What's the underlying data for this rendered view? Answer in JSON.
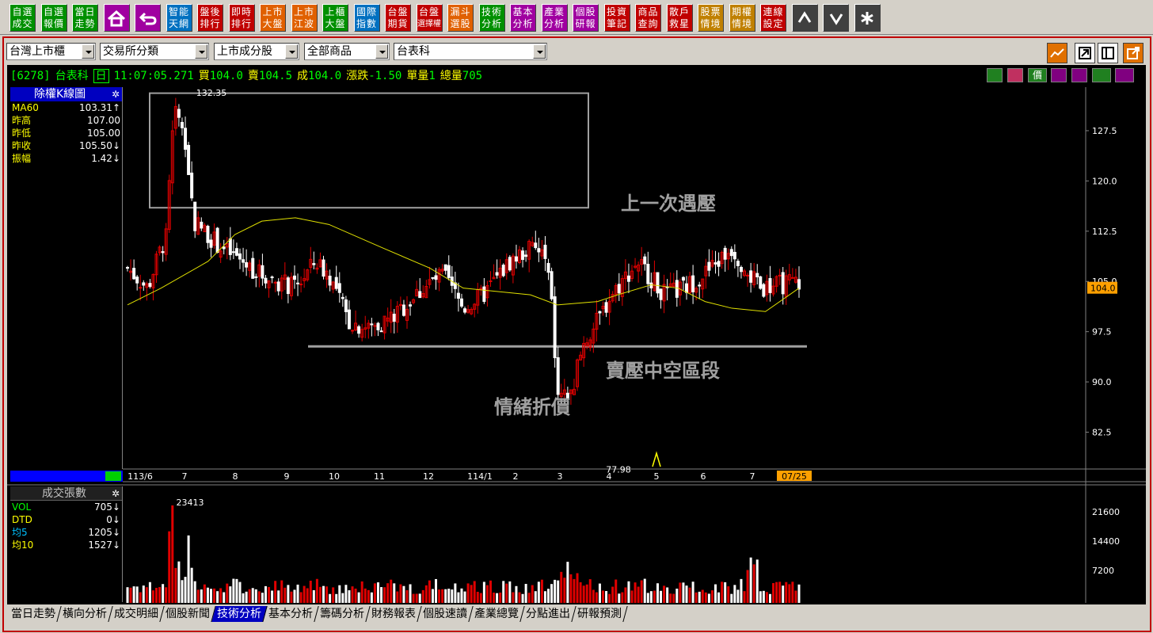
{
  "toolbar": {
    "buttons": [
      {
        "l1": "自選",
        "l2": "成交",
        "bg": "#009000"
      },
      {
        "l1": "自選",
        "l2": "報價",
        "bg": "#009000"
      },
      {
        "l1": "當日",
        "l2": "走勢",
        "bg": "#009000"
      },
      {
        "icon": "home-icon",
        "bg": "#a000a0"
      },
      {
        "icon": "back-icon",
        "bg": "#a000a0"
      },
      {
        "l1": "智能",
        "l2": "天網",
        "bg": "#0070c0"
      },
      {
        "l1": "盤後",
        "l2": "排行",
        "bg": "#c00000"
      },
      {
        "l1": "即時",
        "l2": "排行",
        "bg": "#c00000"
      },
      {
        "l1": "上市",
        "l2": "大盤",
        "bg": "#e06000"
      },
      {
        "l1": "上市",
        "l2": "江波",
        "bg": "#e06000"
      },
      {
        "l1": "上櫃",
        "l2": "大盤",
        "bg": "#009000"
      },
      {
        "l1": "國際",
        "l2": "指數",
        "bg": "#0070c0"
      },
      {
        "l1": "台盤",
        "l2": "期貨",
        "bg": "#c00000"
      },
      {
        "l1": "台盤",
        "l2": "選擇權",
        "bg": "#c00000"
      },
      {
        "l1": "漏斗",
        "l2": "選股",
        "bg": "#e06000"
      },
      {
        "l1": "技術",
        "l2": "分析",
        "bg": "#009000"
      },
      {
        "l1": "基本",
        "l2": "分析",
        "bg": "#a000a0"
      },
      {
        "l1": "產業",
        "l2": "分析",
        "bg": "#a000a0"
      },
      {
        "l1": "個股",
        "l2": "研報",
        "bg": "#a000a0"
      },
      {
        "l1": "投資",
        "l2": "筆記",
        "bg": "#c00000"
      },
      {
        "l1": "商品",
        "l2": "查詢",
        "bg": "#c00000"
      },
      {
        "l1": "散戶",
        "l2": "救星",
        "bg": "#c00000"
      },
      {
        "l1": "股票",
        "l2": "情境",
        "bg": "#c08000"
      },
      {
        "l1": "期權",
        "l2": "情境",
        "bg": "#c08000"
      },
      {
        "l1": "連線",
        "l2": "設定",
        "bg": "#c00000"
      },
      {
        "icon": "arrow-up-icon",
        "bg": "#404040"
      },
      {
        "icon": "arrow-down-icon",
        "bg": "#404040"
      },
      {
        "icon": "asterisk-icon",
        "bg": "#404040"
      }
    ]
  },
  "selectors": [
    "台灣上市櫃",
    "交易所分類",
    "上市成分股",
    "全部商品",
    "台表科"
  ],
  "quote": {
    "code": "[6278]",
    "name": "台表科",
    "day": "日",
    "time": "11:07:05.271",
    "bid_label": "買",
    "bid": "104.0",
    "ask_label": "賣",
    "ask": "104.5",
    "deal_label": "成",
    "deal": "104.0",
    "chg_label": "漲跌",
    "chg": "-1.50",
    "unit_label": "單量",
    "unit": "1",
    "total_label": "總量",
    "total": "705",
    "price_label": "價"
  },
  "panel1": {
    "title": "除權K線圖",
    "rows": [
      {
        "name": "MA60",
        "value": "103.31",
        "arrow": "↑"
      },
      {
        "name": "昨高",
        "value": "107.00",
        "arrow": ""
      },
      {
        "name": "昨低",
        "value": "105.00",
        "arrow": ""
      },
      {
        "name": "昨收",
        "value": "105.50",
        "arrow": "↓"
      },
      {
        "name": "振幅",
        "value": "1.42",
        "arrow": "↓"
      }
    ]
  },
  "panel2": {
    "title": "成交張數",
    "rows": [
      {
        "name": "VOL",
        "value": "705",
        "arrow": "↓"
      },
      {
        "name": "DTD",
        "value": "0",
        "arrow": "↓"
      },
      {
        "name": "均5",
        "value": "1205",
        "arrow": "↓"
      },
      {
        "name": "均10",
        "value": "1527",
        "arrow": "↓"
      }
    ]
  },
  "chart_data": {
    "type": "candlestick",
    "price_ticks": [
      "127.5",
      "120.0",
      "112.5",
      "105.0",
      "97.5",
      "90.0",
      "82.5"
    ],
    "price_ylim": [
      77,
      134
    ],
    "last_price": "104.0",
    "high_label": "132.35",
    "low_label": "77.98",
    "x_labels": [
      "113/6",
      "7",
      "8",
      "9",
      "10",
      "11",
      "12",
      "114/1",
      "2",
      "3",
      "4",
      "5",
      "6",
      "7",
      "07/25"
    ],
    "volume_ticks": [
      "21600",
      "14400",
      "7200"
    ],
    "volume_peak_label": "23413",
    "annotations": [
      "上一次遇壓",
      "賣壓中空區段",
      "情緒折價"
    ],
    "colors": {
      "up": "#e00000",
      "down": "#ffffff",
      "ma": "#e0e000",
      "box": "#a0a0a0",
      "support": "#a0a0a0"
    },
    "support_level": 95.3,
    "box": {
      "from": "113/6 late",
      "to": "3",
      "low": 116,
      "high": 133
    },
    "ma60_path": [
      [
        0,
        101.5
      ],
      [
        0.05,
        104
      ],
      [
        0.12,
        108
      ],
      [
        0.16,
        112
      ],
      [
        0.2,
        114
      ],
      [
        0.25,
        114.5
      ],
      [
        0.3,
        113.5
      ],
      [
        0.38,
        110
      ],
      [
        0.45,
        107
      ],
      [
        0.5,
        104
      ],
      [
        0.55,
        103.5
      ],
      [
        0.6,
        103
      ],
      [
        0.64,
        101.5
      ],
      [
        0.7,
        102
      ],
      [
        0.73,
        103
      ],
      [
        0.78,
        104.5
      ],
      [
        0.82,
        104
      ],
      [
        0.86,
        102
      ],
      [
        0.9,
        101
      ],
      [
        0.95,
        100.5
      ],
      [
        1,
        104
      ]
    ]
  },
  "tabs": [
    "當日走勢",
    "橫向分析",
    "成交明細",
    "個股新聞",
    "技術分析",
    "基本分析",
    "籌碼分析",
    "財務報表",
    "個股速讀",
    "產業總覽",
    "分點進出",
    "研報預測"
  ],
  "active_tab": "技術分析"
}
